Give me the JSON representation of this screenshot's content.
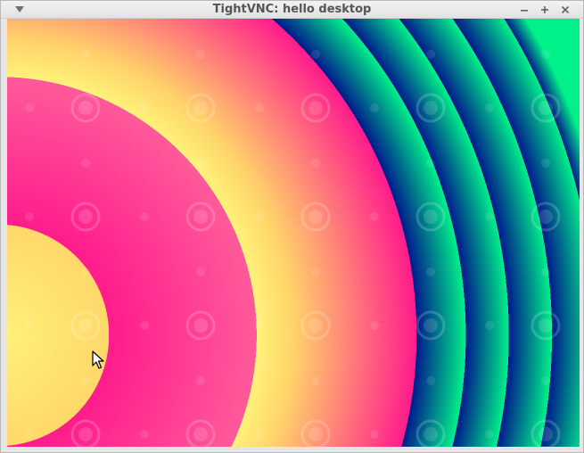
{
  "window": {
    "title": "TightVNC: hello desktop"
  },
  "icons": {
    "menu": "chevron-down-icon",
    "minimize": "minimize-icon",
    "maximize": "maximize-icon",
    "close": "close-icon",
    "cursor": "mouse-pointer-icon"
  },
  "colors": {
    "yellow": "#fff27a",
    "pink": "#ff1c8c",
    "navy": "#001a8c",
    "green": "#00f08a"
  }
}
